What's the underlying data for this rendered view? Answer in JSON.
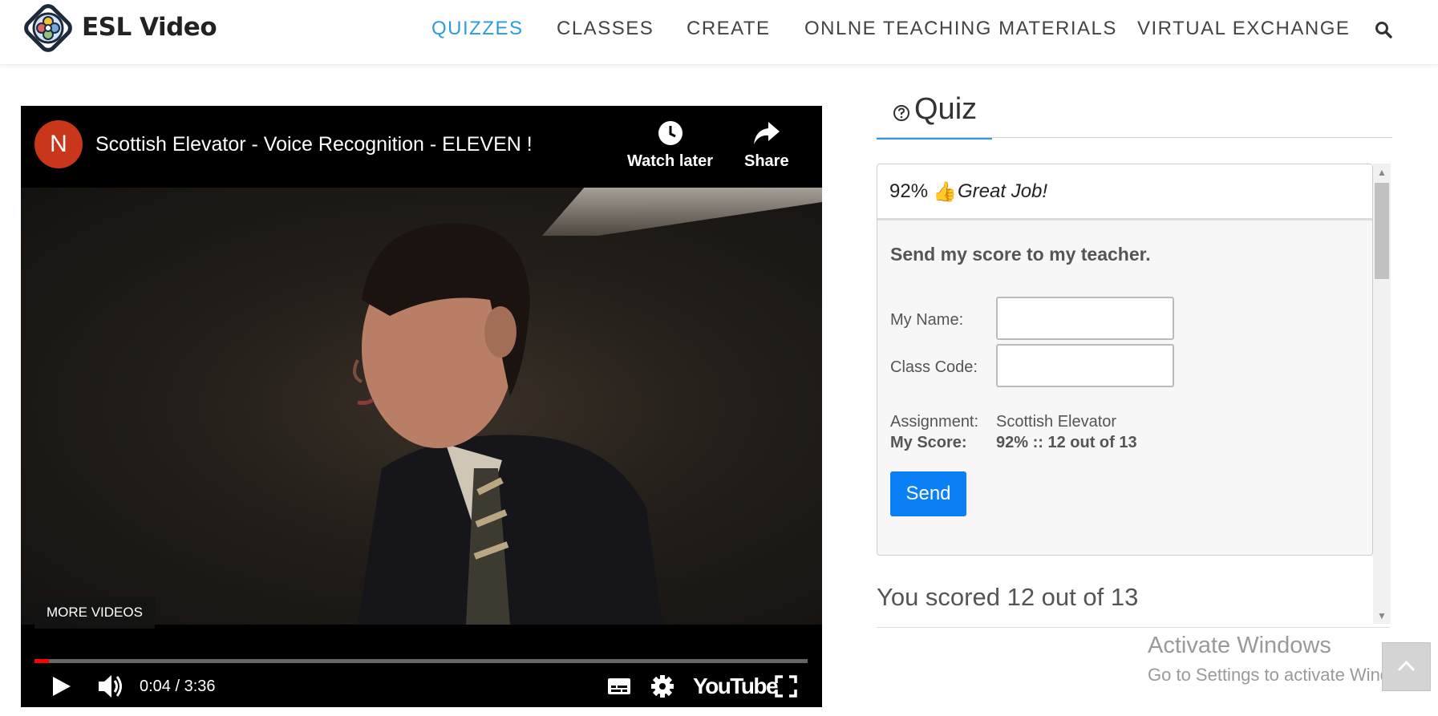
{
  "header": {
    "brand": "ESL Video",
    "nav": [
      {
        "label": "QUIZZES",
        "active": true
      },
      {
        "label": "CLASSES",
        "active": false
      },
      {
        "label": "CREATE",
        "active": false
      },
      {
        "label": "ONLNE TEACHING MATERIALS",
        "active": false
      },
      {
        "label": "VIRTUAL EXCHANGE",
        "active": false
      }
    ],
    "search_icon": "search-icon",
    "accent_color": "#2b9be0"
  },
  "video": {
    "channel_initial": "N",
    "title": "Scottish Elevator - Voice Recognition - ELEVEN !",
    "watch_later": "Watch later",
    "share": "Share",
    "more_videos": "MORE VIDEOS",
    "time": "0:04 / 3:36",
    "progress_fraction": 0.0185,
    "youtube": "YouTube"
  },
  "quiz": {
    "tab_title": "Quiz",
    "score_percent": "92%",
    "great_job": "Great Job!",
    "send_title": "Send my score to my teacher.",
    "name_label": "My Name:",
    "class_code_label": "Class Code:",
    "assignment_label": "Assignment:",
    "assignment_value": "Scottish Elevator",
    "my_score_label": "My Score:",
    "my_score_value": "92% :: 12 out of 13",
    "send_button": "Send",
    "scored_text": "You scored 12 out of 13",
    "send_button_color": "#0b7ff5"
  },
  "windows": {
    "activate_title": "Activate Windows",
    "activate_sub": "Go to Settings to activate Windows."
  }
}
